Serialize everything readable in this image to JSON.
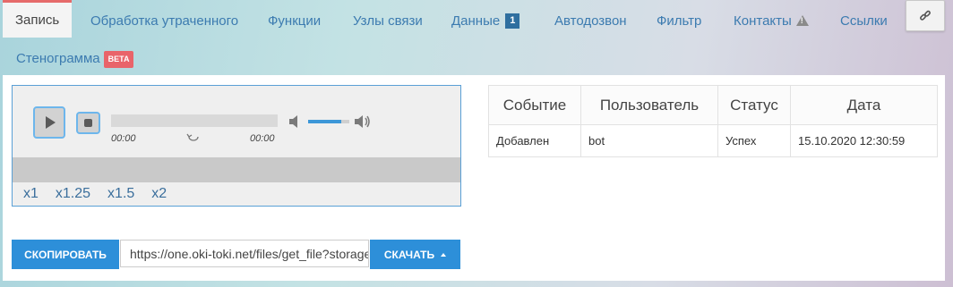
{
  "tabs": {
    "record": "Запись",
    "lost_processing": "Обработка утраченного",
    "functions": "Функции",
    "nodes": "Узлы связи",
    "data": "Данные",
    "data_badge": "1",
    "autodial": "Автодозвон",
    "filter": "Фильтр",
    "contacts": "Контакты",
    "links": "Ссылки",
    "transcript": "Стенограмма",
    "transcript_badge": "BETA"
  },
  "player": {
    "current_time": "00:00",
    "duration": "00:00",
    "volume_level": 0.8,
    "speeds": [
      "x1",
      "x1.25",
      "x1.5",
      "x2"
    ]
  },
  "events_table": {
    "headers": [
      "Событие",
      "Пользователь",
      "Статус",
      "Дата"
    ],
    "rows": [
      [
        "Добавлен",
        "bot",
        "Успех",
        "15.10.2020 12:30:59"
      ]
    ]
  },
  "actions": {
    "copy_label": "СКОПИРОВАТЬ",
    "url_value": "https://one.oki-toki.net/files/get_file?storage",
    "download_label": "СКАЧАТЬ"
  },
  "colors": {
    "accent": "#2d8fd9",
    "link": "#3c7bb0",
    "active_tab_border": "#e66a6a",
    "beta_badge": "#e9646a"
  },
  "icons": [
    "play-icon",
    "stop-icon",
    "repeat-icon",
    "mute-icon",
    "volume-max-icon",
    "warning-icon",
    "link-icon",
    "caret-up-icon"
  ]
}
